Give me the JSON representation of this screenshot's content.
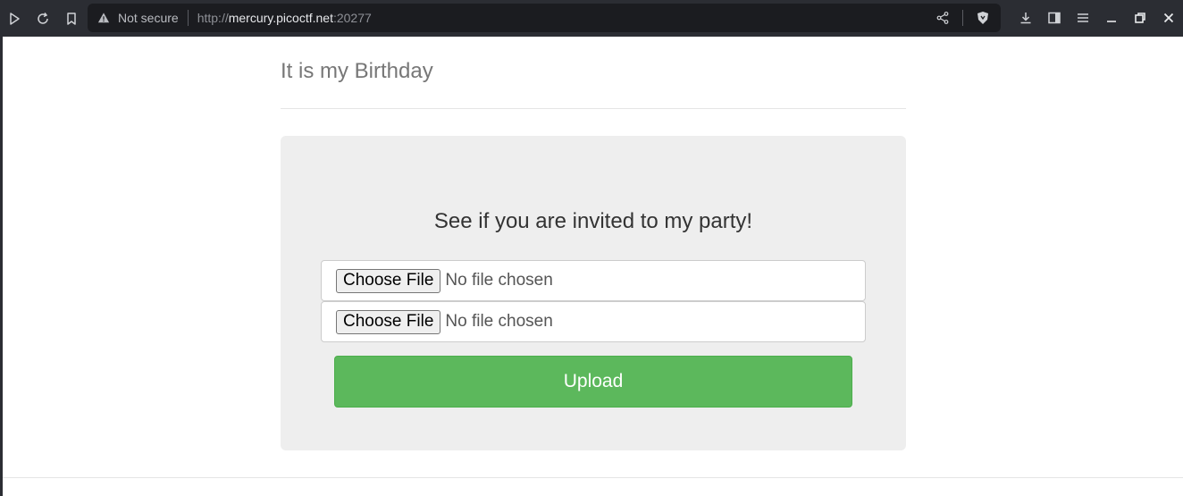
{
  "browser": {
    "security_label": "Not secure",
    "url_scheme": "http://",
    "url_host": "mercury.picoctf.net",
    "url_port": ":20277"
  },
  "page": {
    "title": "It is my Birthday",
    "heading": "See if you are invited to my party!",
    "file_inputs": [
      {
        "button_label": "Choose File",
        "status": "No file chosen"
      },
      {
        "button_label": "Choose File",
        "status": "No file chosen"
      }
    ],
    "upload_label": "Upload"
  },
  "colors": {
    "upload": "#5cb85c",
    "panel": "#eeeeee",
    "chrome": "#2b2d33"
  }
}
